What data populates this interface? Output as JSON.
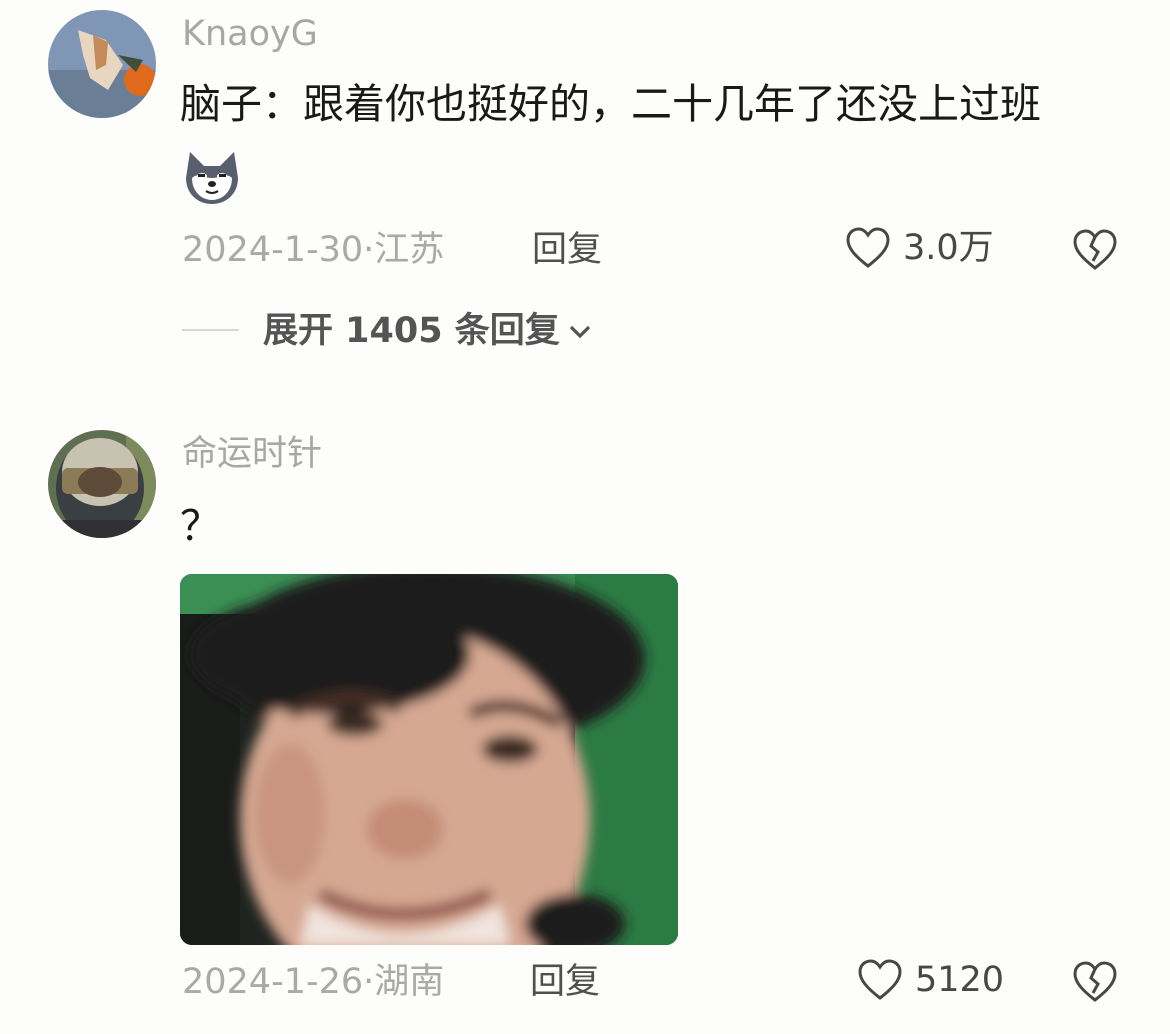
{
  "comments": [
    {
      "username": "KnaoyG",
      "text": "脑子：跟着你也挺好的，二十几年了还没上过班",
      "emoji": "husky-dog-emoji",
      "date": "2024-1-30",
      "location": "江苏",
      "reply_label": "回复",
      "likes": "3.0万",
      "expand_label": "展开 1405 条回复"
    },
    {
      "username": "命运时针",
      "text": "？",
      "date": "2024-1-26",
      "location": "湖南",
      "reply_label": "回复",
      "likes": "5120"
    }
  ],
  "colors": {
    "background": "#fdfdfb",
    "meta": "#a9a9a9",
    "text": "#191919"
  }
}
